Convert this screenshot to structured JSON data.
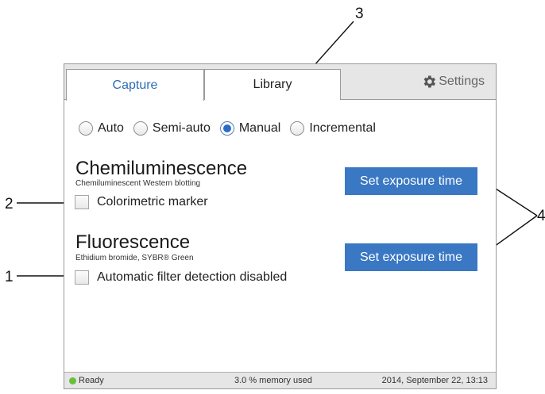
{
  "callouts": [
    "1",
    "2",
    "3",
    "4"
  ],
  "tabs": {
    "capture": "Capture",
    "library": "Library",
    "settings": "Settings"
  },
  "modes": {
    "options": [
      "Auto",
      "Semi-auto",
      "Manual",
      "Incremental"
    ],
    "selected": "Manual"
  },
  "chemi": {
    "title": "Chemiluminescence",
    "subtitle": "Chemiluminescent Western blotting",
    "checkbox_label": "Colorimetric marker",
    "checked": false,
    "button": "Set exposure time"
  },
  "fluor": {
    "title": "Fluorescence",
    "subtitle": "Ethidium bromide, SYBR® Green",
    "checkbox_label": "Automatic filter detection disabled",
    "checked": false,
    "button": "Set exposure time"
  },
  "status": {
    "state": "Ready",
    "memory": "3.0 % memory used",
    "datetime": "2014, September 22, 13:13",
    "ready_color": "#6cbf3a"
  },
  "colors": {
    "accent": "#3a78c4",
    "radio_selected": "#2c6cc4"
  }
}
